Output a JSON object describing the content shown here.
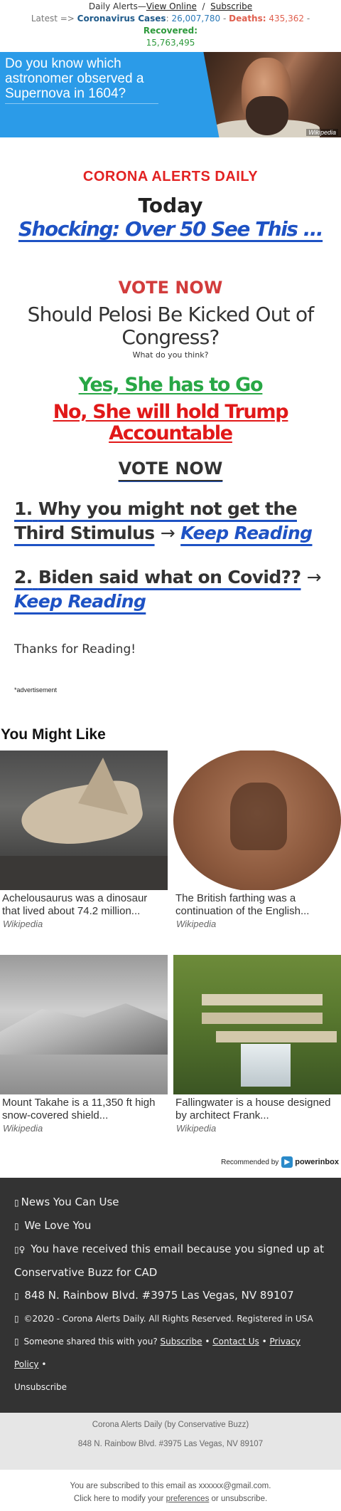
{
  "header": {
    "prefix": "Daily Alerts—",
    "view_online": "View Online",
    "separator": "/",
    "subscribe": "Subscribe"
  },
  "ticker": {
    "latest": "Latest =>",
    "cases_label": "Coronavirus Cases",
    "cases_value": "26,007,780",
    "deaths_label": "Deaths",
    "deaths_value": "435,362",
    "recovered_label": "Recovered",
    "recovered_value": "15,763,495"
  },
  "banner": {
    "text": "Do you know which astronomer observed a Supernova in 1604?",
    "credit": "Wikipedia"
  },
  "main": {
    "brand": "CORONA ALERTS DAILY",
    "today": "Today",
    "headline": "Shocking: Over 50 See This ...",
    "vote_label": "VOTE NOW",
    "poll_question": "Should Pelosi Be Kicked Out of Congress?",
    "poll_subtext": "What do you think?",
    "poll_yes": "Yes, She has to Go",
    "poll_no": "No, She will hold Trump Accountable",
    "vote_label_2": "VOTE NOW"
  },
  "stories": [
    {
      "number": "1.",
      "title": "Why you might not get the Third Stimulus",
      "arrow": "→",
      "link": "Keep Reading"
    },
    {
      "number": "2.",
      "title": "Biden said what on Covid??",
      "arrow": "→",
      "link": "Keep Reading"
    }
  ],
  "thanks": "Thanks for Reading!",
  "ad_label": "*advertisement",
  "recommendations": {
    "heading": "You Might Like",
    "items": [
      {
        "title": "Achelousaurus was a dinosaur that lived about 74.2 million...",
        "source": "Wikipedia",
        "image": "dinosaur-skull"
      },
      {
        "title": "The British farthing was a continuation of the English...",
        "source": "Wikipedia",
        "image": "farthing-coin"
      },
      {
        "title": "Mount Takahe is a 11,350 ft high snow-covered shield...",
        "source": "Wikipedia",
        "image": "mountain-aerial"
      },
      {
        "title": "Fallingwater is a house designed by architect Frank...",
        "source": "Wikipedia",
        "image": "fallingwater-house"
      }
    ],
    "recommended_by": "Recommended by",
    "provider": "powerinbox"
  },
  "footer": {
    "news": "News You Can Use",
    "love": "We Love You",
    "reason": "You have received this email because you signed up at Conservative Buzz for CAD",
    "address": "848 N. Rainbow Blvd. #3975 Las Vegas, NV 89107",
    "copyright": "©2020 - Corona Alerts Daily. All Rights Reserved. Registered in USA",
    "shared": "Someone shared this with you?",
    "subscribe": "Subscribe",
    "contact": "Contact Us",
    "privacy": "Privacy Policy",
    "bullet": "•",
    "unsubscribe": "Unsubscribe"
  },
  "gray_footer": {
    "sender": "Corona Alerts Daily (by Conservative Buzz)",
    "address": "848 N. Rainbow Blvd. #3975 Las Vegas, NV 89107"
  },
  "fine_print": {
    "subscribed": "You are subscribed to this email as xxxxxx@gmail.com.",
    "modify_prefix": "Click here to modify your",
    "preferences": "preferences",
    "modify_suffix": "or unsubscribe."
  },
  "colors": {
    "brand_red": "#e22222",
    "link_blue": "#1e52c4",
    "yes_green": "#28a745",
    "no_red": "#e11919",
    "banner_blue": "#2b9be8",
    "footer_dark": "#333333"
  }
}
